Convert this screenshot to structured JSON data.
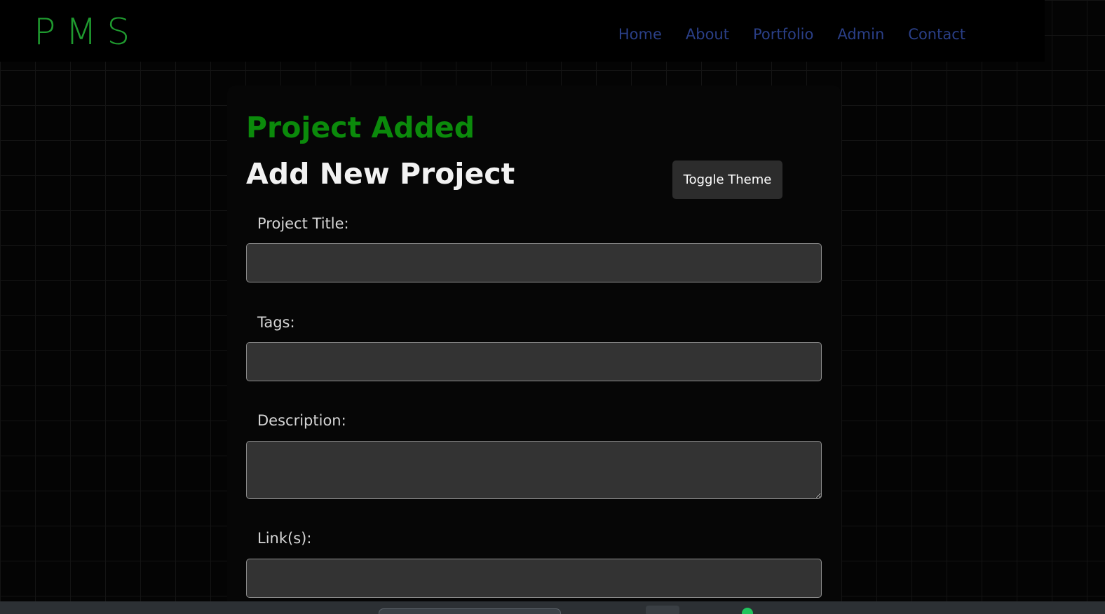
{
  "header": {
    "logo": "PMS",
    "nav": [
      "Home",
      "About",
      "Portfolio",
      "Admin",
      "Contact"
    ]
  },
  "form": {
    "status_message": "Project Added",
    "title": "Add New Project",
    "toggle_theme_label": "Toggle Theme",
    "fields": {
      "project_title": {
        "label": "Project Title:",
        "value": ""
      },
      "tags": {
        "label": "Tags:",
        "value": ""
      },
      "description": {
        "label": "Description:",
        "value": ""
      },
      "links": {
        "label": "Link(s):",
        "value": ""
      }
    }
  },
  "colors": {
    "logo": "#1f9a2f",
    "nav_link": "#2a3f87",
    "status_message": "#0b8a0b",
    "input_background": "#333333",
    "button_background": "#2c2c2c"
  }
}
